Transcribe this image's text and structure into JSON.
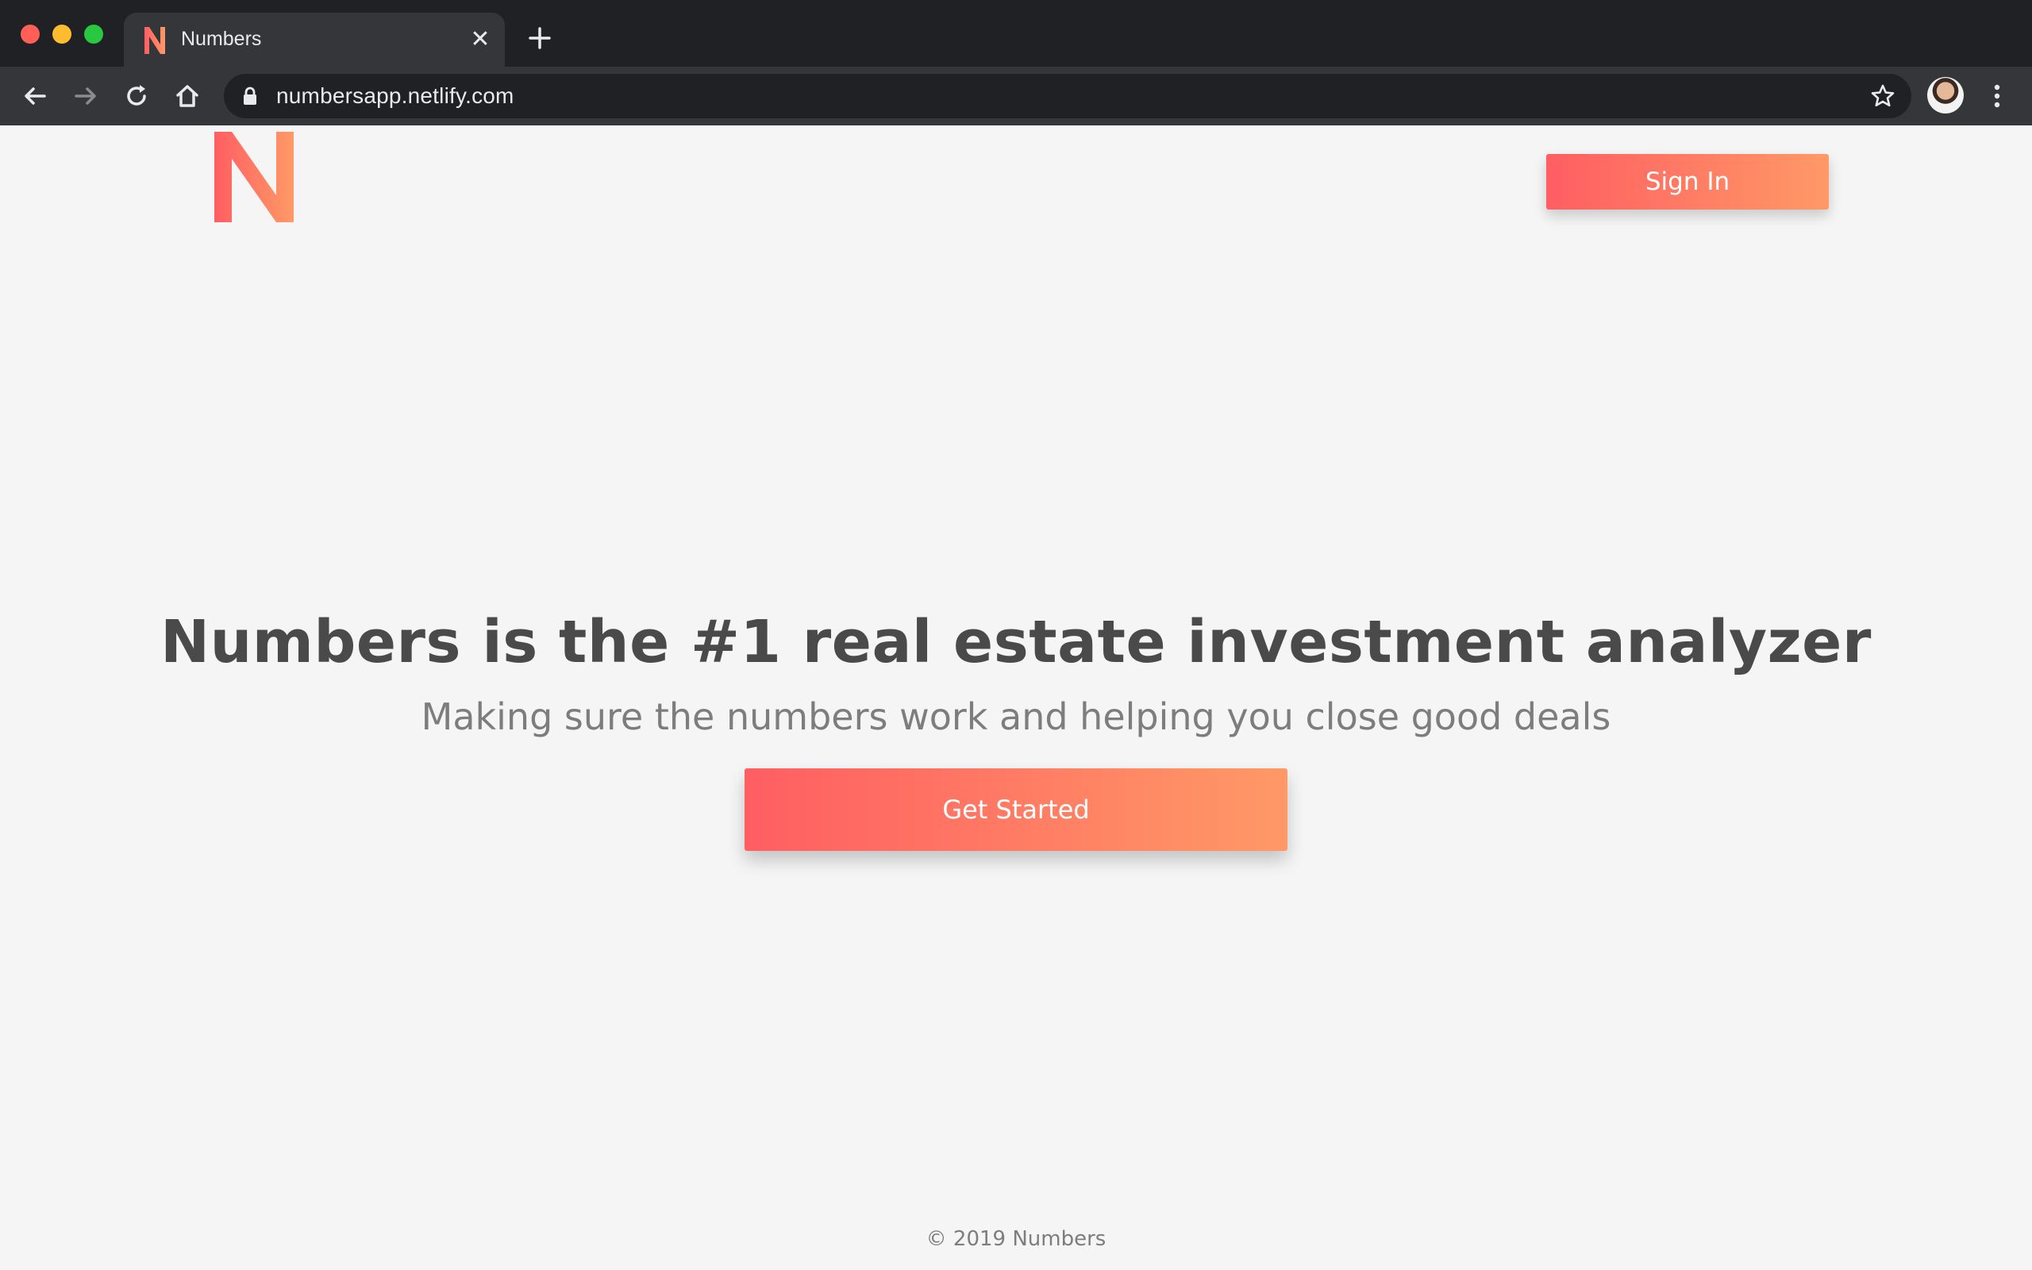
{
  "browser": {
    "tab": {
      "title": "Numbers",
      "close": "✕",
      "favicon": "N"
    },
    "new_tab": "+",
    "url": "numbersapp.netlify.com"
  },
  "page": {
    "logo": "N",
    "sign_in_label": "Sign In",
    "hero": {
      "title": "Numbers is the #1 real estate investment analyzer",
      "subtitle": "Making sure the numbers work and helping you close good deals",
      "cta_label": "Get Started"
    },
    "footer": "© 2019 Numbers"
  },
  "colors": {
    "accent_start": "#ff5e62",
    "accent_end": "#ff9966",
    "heading": "#4a4a4a",
    "muted": "#7d7d7d",
    "page_bg": "#f5f5f5"
  }
}
